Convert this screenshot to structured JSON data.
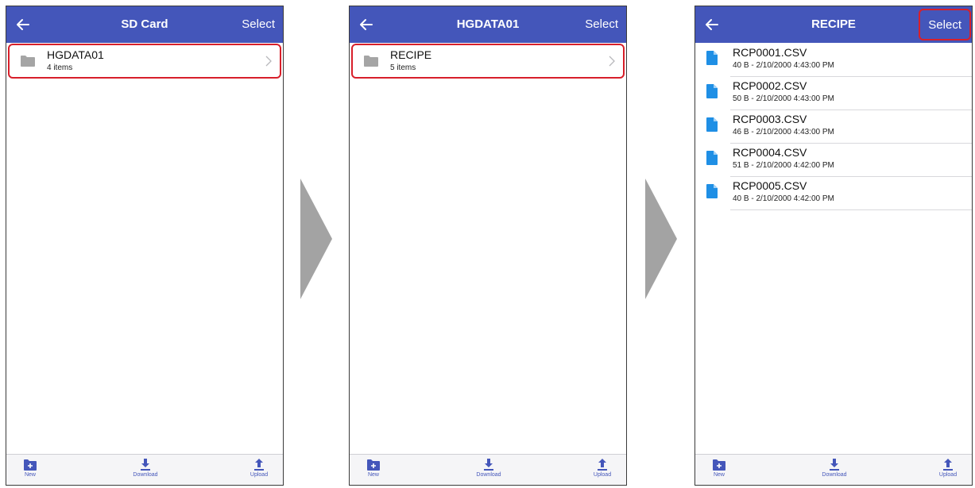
{
  "colors": {
    "nav_bar": "#4456ba",
    "highlight_border": "#d81f2a",
    "folder_icon": "#a5a5a5",
    "file_icon": "#1f8fe5",
    "step_arrow": "#a3a3a3"
  },
  "screen1": {
    "title": "SD Card",
    "select_label": "Select",
    "folder": {
      "name": "HGDATA01",
      "count": "4 items"
    }
  },
  "screen2": {
    "title": "HGDATA01",
    "select_label": "Select",
    "folder": {
      "name": "RECIPE",
      "count": "5 items"
    }
  },
  "screen3": {
    "title": "RECIPE",
    "select_label": "Select",
    "files": [
      {
        "name": "RCP0001.CSV",
        "meta": "40 B - 2/10/2000 4:43:00 PM"
      },
      {
        "name": "RCP0002.CSV",
        "meta": "50 B - 2/10/2000 4:43:00 PM"
      },
      {
        "name": "RCP0003.CSV",
        "meta": "46 B - 2/10/2000 4:43:00 PM"
      },
      {
        "name": "RCP0004.CSV",
        "meta": "51 B - 2/10/2000 4:42:00 PM"
      },
      {
        "name": "RCP0005.CSV",
        "meta": "40 B - 2/10/2000 4:42:00 PM"
      }
    ]
  },
  "toolbar": {
    "new_label": "New",
    "download_label": "Download",
    "upload_label": "Upload"
  },
  "icons": {
    "back": "arrow-left-icon",
    "folder": "folder-icon",
    "chevron": "chevron-right-icon",
    "file": "file-icon",
    "new": "new-folder-icon",
    "download": "download-icon",
    "upload": "upload-icon",
    "step": "step-arrow-icon"
  }
}
